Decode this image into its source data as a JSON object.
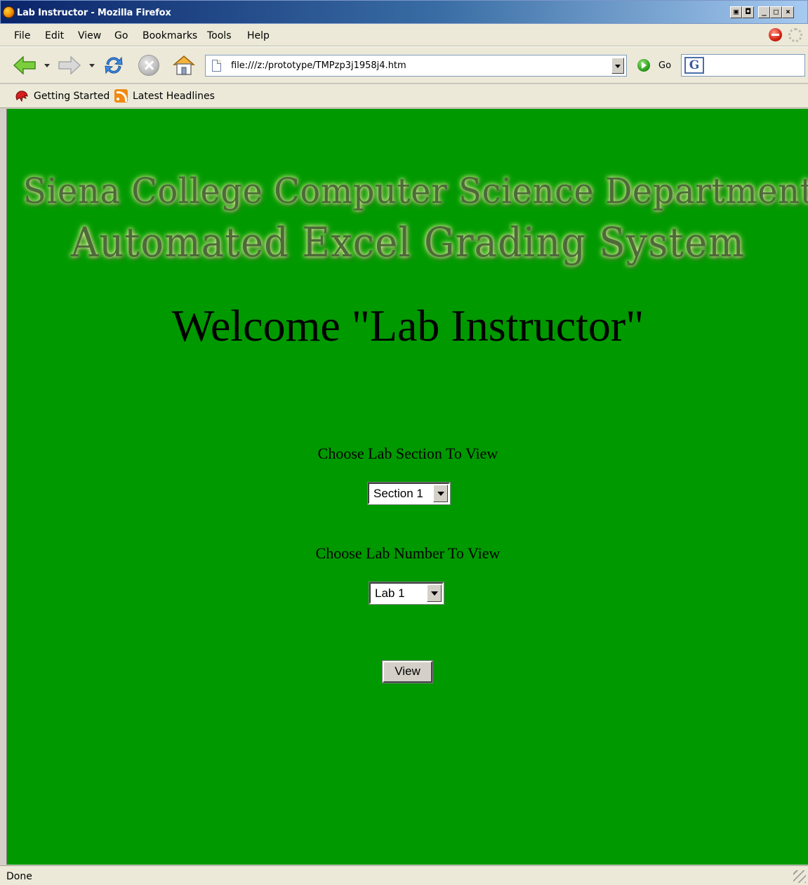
{
  "window": {
    "title": "Lab Instructor - Mozilla Firefox",
    "controls": [
      "restore",
      "minimize",
      "maximize",
      "close"
    ]
  },
  "menubar": {
    "items": [
      "File",
      "Edit",
      "View",
      "Go",
      "Bookmarks",
      "Tools",
      "Help"
    ]
  },
  "toolbar": {
    "url": "file:///z:/prototype/TMPzp3j1958j4.htm",
    "go_label": "Go",
    "search_value": "",
    "search_engine_icon": "google-icon"
  },
  "bookmarks": {
    "items": [
      {
        "label": "Getting Started",
        "icon": "getting-started-icon"
      },
      {
        "label": "Latest Headlines",
        "icon": "rss-icon"
      }
    ]
  },
  "page": {
    "background_color": "#009900",
    "banner_line1": "Siena College Computer Science Department",
    "banner_line2": "Automated Excel Grading System",
    "welcome": "Welcome \"Lab Instructor\"",
    "section_label": "Choose Lab Section To View",
    "section_selected": "Section 1",
    "lab_label": "Choose Lab Number To View",
    "lab_selected": "Lab 1",
    "view_button": "View"
  },
  "status": {
    "text": "Done"
  }
}
